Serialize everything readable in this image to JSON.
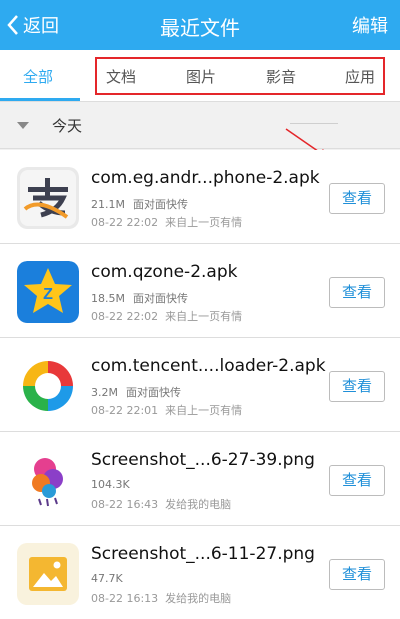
{
  "header": {
    "back_label": "返回",
    "title": "最近文件",
    "edit_label": "编辑",
    "accent_color": "#2eaaf0"
  },
  "tabs": [
    {
      "label": "全部",
      "active": true
    },
    {
      "label": "文档",
      "active": false
    },
    {
      "label": "图片",
      "active": false
    },
    {
      "label": "影音",
      "active": false
    },
    {
      "label": "应用",
      "active": false
    }
  ],
  "section": {
    "label": "今天",
    "icon": "collapse-triangle-icon"
  },
  "annotation": {
    "highlight_color": "#e4262a",
    "icon": "red-arrow-icon"
  },
  "files": [
    {
      "name": "com.eg.andr...phone-2.apk",
      "size": "21.1M",
      "source": "面对面快传",
      "date": "08-22 22:02",
      "note": "来自上一页有情",
      "icon": "alipay-icon",
      "view_label": "查看"
    },
    {
      "name": "com.qzone-2.apk",
      "size": "18.5M",
      "source": "面对面快传",
      "date": "08-22 22:02",
      "note": "来自上一页有情",
      "icon": "qzone-icon",
      "view_label": "查看"
    },
    {
      "name": "com.tencent....loader-2.apk",
      "size": "3.2M",
      "source": "面对面快传",
      "date": "08-22 22:01",
      "note": "来自上一页有情",
      "icon": "tencent-downloader-icon",
      "view_label": "查看"
    },
    {
      "name": "Screenshot_...6-27-39.png",
      "size": "104.3K",
      "source": "",
      "date": "08-22 16:43",
      "note": "发给我的电脑",
      "icon": "colorful-image-icon",
      "view_label": "查看"
    },
    {
      "name": "Screenshot_...6-11-27.png",
      "size": "47.7K",
      "source": "",
      "date": "08-22 16:13",
      "note": "发给我的电脑",
      "icon": "image-icon",
      "view_label": "查看"
    }
  ]
}
